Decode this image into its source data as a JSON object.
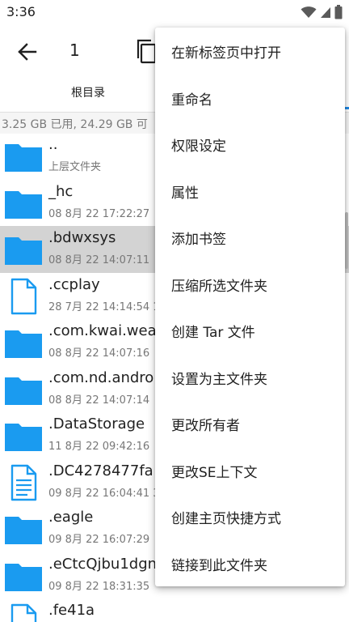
{
  "status_bar": {
    "time": "3:36"
  },
  "app_bar": {
    "title": "1"
  },
  "tabs": {
    "root_label": "根目录"
  },
  "storage": {
    "text": "3.25 GB 已用, 24.29 GB 可"
  },
  "files": [
    {
      "name": "..",
      "meta": "上层文件夹",
      "type": "folder",
      "selected": false
    },
    {
      "name": "_hc",
      "meta": "08 8月 22 17:22:27",
      "type": "folder",
      "selected": false
    },
    {
      "name": ".bdwxsys",
      "meta": "08 8月 22 14:07:11",
      "type": "folder",
      "selected": true
    },
    {
      "name": ".ccplay",
      "meta": "28 7月 22 14:14:54  1",
      "type": "file",
      "selected": false
    },
    {
      "name": ".com.kwai.wea",
      "meta": "08 8月 22 14:07:16",
      "type": "folder",
      "selected": false
    },
    {
      "name": ".com.nd.andro",
      "meta": "08 8月 22 14:07:14",
      "type": "folder",
      "selected": false
    },
    {
      "name": ".DataStorage",
      "meta": "11 8月 22 09:42:16",
      "type": "folder",
      "selected": false
    },
    {
      "name": ".DC4278477fa",
      "meta": "09 8月 22 16:04:41  3",
      "type": "doc",
      "selected": false
    },
    {
      "name": ".eagle",
      "meta": "09 8月 22 16:07:29",
      "type": "folder",
      "selected": false
    },
    {
      "name": ".eCtcQjbu1dgn",
      "meta": "09 8月 22 18:31:35",
      "type": "folder",
      "selected": false
    },
    {
      "name": ".fe41a",
      "meta": "",
      "type": "file",
      "selected": false
    }
  ],
  "menu": {
    "items": [
      "在新标签页中打开",
      "重命名",
      "权限设定",
      "属性",
      "添加书签",
      "压缩所选文件夹",
      "创建 Tar 文件",
      "设置为主文件夹",
      "更改所有者",
      "更改SE上下文",
      "创建主页快捷方式",
      "链接到此文件夹"
    ]
  },
  "colors": {
    "folder": "#1a9bf0",
    "accent": "#1e88e5",
    "selected_row": "#d3d3d3"
  },
  "icons": [
    "wifi-icon",
    "signal-icon",
    "battery-icon",
    "back-arrow-icon",
    "copy-icon",
    "folder-icon",
    "file-icon",
    "document-icon"
  ]
}
